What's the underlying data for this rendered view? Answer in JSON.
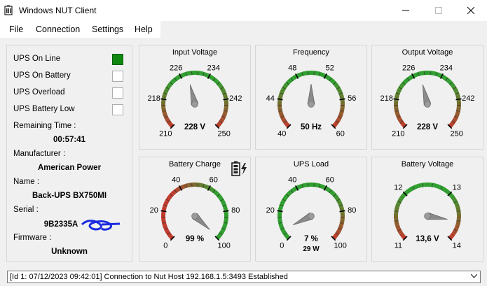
{
  "window": {
    "title": "Windows NUT Client"
  },
  "menu": {
    "file": "File",
    "connection": "Connection",
    "settings": "Settings",
    "help": "Help"
  },
  "status_flags": [
    {
      "label": "UPS On Line",
      "active": true
    },
    {
      "label": "UPS On Battery",
      "active": false
    },
    {
      "label": "UPS Overload",
      "active": false
    },
    {
      "label": "UPS Battery Low",
      "active": false
    }
  ],
  "info": {
    "remaining_time_label": "Remaining Time :",
    "remaining_time": "00:57:41",
    "manufacturer_label": "Manufacturer :",
    "manufacturer": "American Power",
    "name_label": "Name :",
    "name": "Back-UPS BX750MI",
    "serial_label": "Serial :",
    "serial": "9B2335A",
    "firmware_label": "Firmware :",
    "firmware": "Unknown"
  },
  "gauges": [
    {
      "title": "Input Voltage",
      "min": 210,
      "max": 250,
      "value": 228,
      "display": "228 V",
      "ticks": [
        "210",
        "218",
        "226",
        "234",
        "242",
        "250"
      ],
      "colors": [
        "#c0392b",
        "#2e9e2e",
        "#2e9e2e",
        "#c0392b"
      ]
    },
    {
      "title": "Frequency",
      "min": 40,
      "max": 60,
      "value": 50,
      "display": "50 Hz",
      "ticks": [
        "40",
        "44",
        "48",
        "52",
        "56",
        "60"
      ],
      "colors": [
        "#c0392b",
        "#2e9e2e",
        "#2e9e2e",
        "#c0392b"
      ]
    },
    {
      "title": "Output Voltage",
      "min": 210,
      "max": 250,
      "value": 228,
      "display": "228 V",
      "ticks": [
        "210",
        "218",
        "226",
        "234",
        "242",
        "250"
      ],
      "colors": [
        "#c0392b",
        "#2e9e2e",
        "#2e9e2e",
        "#c0392b"
      ]
    },
    {
      "title": "Battery Charge",
      "min": 0,
      "max": 100,
      "value": 99,
      "display": "99 %",
      "sub": "",
      "ticks": [
        "0",
        "20",
        "40",
        "60",
        "80",
        "100"
      ],
      "colors": [
        "#c0392b",
        "#c0392b",
        "#2e9e2e",
        "#2e9e2e"
      ],
      "charging": true
    },
    {
      "title": "UPS Load",
      "min": 0,
      "max": 100,
      "value": 7,
      "display": "7 %",
      "sub": "29 W",
      "ticks": [
        "0",
        "20",
        "40",
        "60",
        "80",
        "100"
      ],
      "colors": [
        "#2e9e2e",
        "#2e9e2e",
        "#2e9e2e",
        "#c0392b"
      ]
    },
    {
      "title": "Battery Voltage",
      "min": 11,
      "max": 14,
      "value": 13.6,
      "display": "13,6 V",
      "ticks": [
        "11",
        "12",
        "13",
        "14"
      ],
      "colors": [
        "#c0392b",
        "#2e9e2e",
        "#2e9e2e",
        "#c0392b"
      ]
    }
  ],
  "status_bar": {
    "text": "[Id 1: 07/12/2023 09:42:01] Connection to Nut Host 192.168.1.5:3493 Established"
  }
}
